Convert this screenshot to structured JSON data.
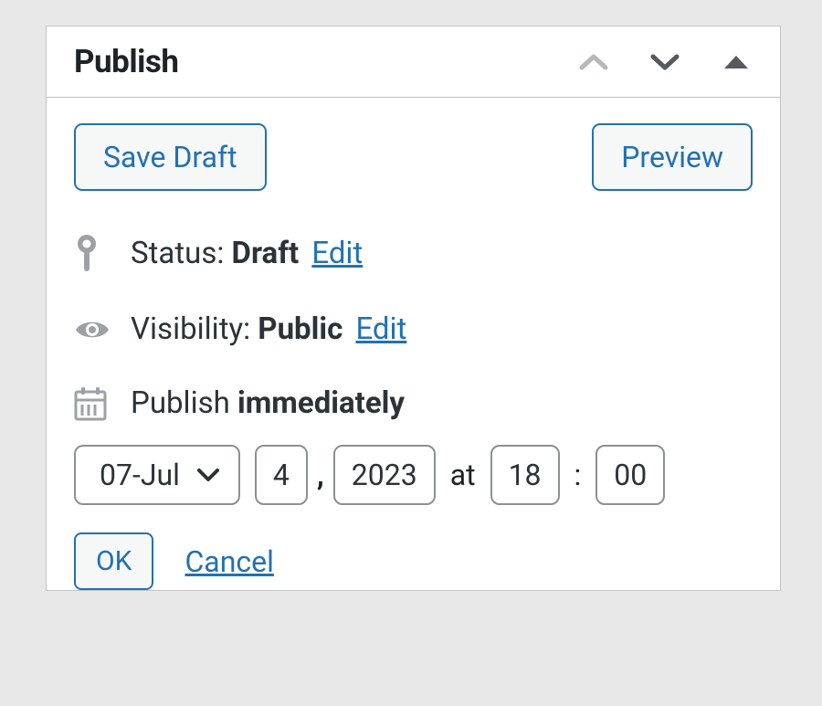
{
  "panel": {
    "title": "Publish",
    "buttons": {
      "save_draft": "Save Draft",
      "preview": "Preview",
      "ok": "OK",
      "cancel": "Cancel"
    },
    "status": {
      "label": "Status:",
      "value": "Draft",
      "edit": "Edit"
    },
    "visibility": {
      "label": "Visibility:",
      "value": "Public",
      "edit": "Edit"
    },
    "publish": {
      "prefix": "Publish",
      "when": "immediately",
      "month": "07-Jul",
      "day": "4",
      "comma": ",",
      "year": "2023",
      "at": "at",
      "hour": "18",
      "colon": ":",
      "minute": "00"
    }
  },
  "colors": {
    "accent": "#2271b1",
    "icon_gray": "#8c8f94",
    "text": "#2c3338"
  }
}
